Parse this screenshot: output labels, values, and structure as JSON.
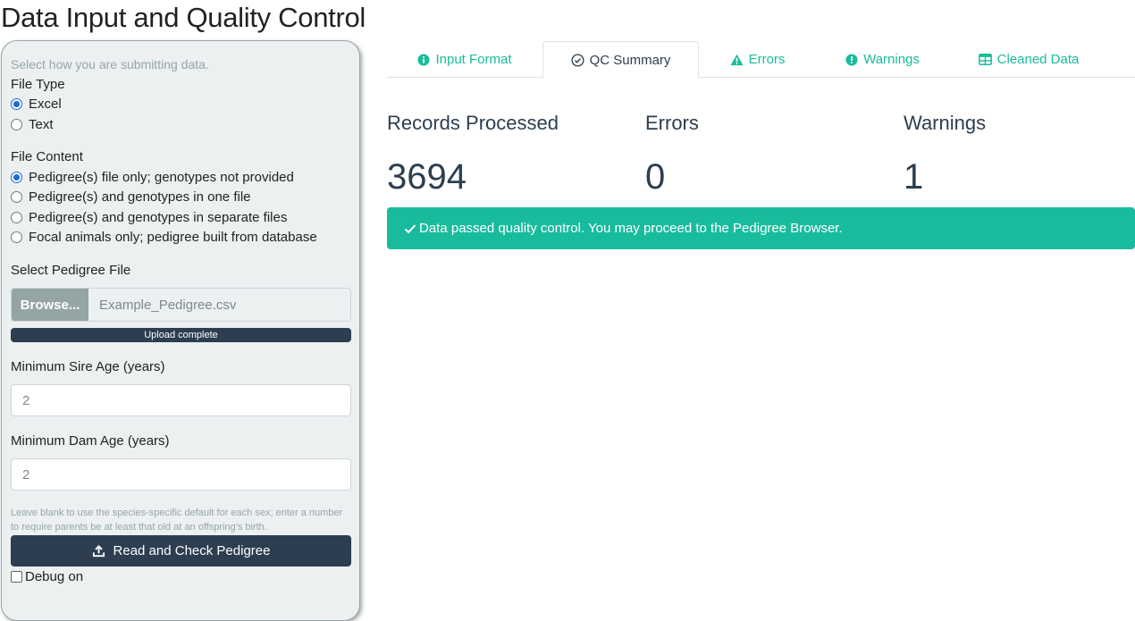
{
  "page": {
    "title": "Data Input and Quality Control"
  },
  "sidebar": {
    "hint": "Select how you are submitting data.",
    "file_type": {
      "label": "File Type",
      "options": [
        "Excel",
        "Text"
      ],
      "selected": "Excel"
    },
    "file_content": {
      "label": "File Content",
      "options": [
        "Pedigree(s) file only; genotypes not provided",
        "Pedigree(s) and genotypes in one file",
        "Pedigree(s) and genotypes in separate files",
        "Focal animals only; pedigree built from database"
      ],
      "selected": "Pedigree(s) file only; genotypes not provided"
    },
    "pedigree_file": {
      "label": "Select Pedigree File",
      "browse_label": "Browse...",
      "file_name": "Example_Pedigree.csv",
      "upload_status": "Upload complete",
      "upload_progress": 1.0
    },
    "min_sire_age": {
      "label": "Minimum Sire Age (years)",
      "value": "2"
    },
    "min_dam_age": {
      "label": "Minimum Dam Age (years)",
      "value": "2"
    },
    "help_text": "Leave blank to use the species-specific default for each sex; enter a number to require parents be at least that old at an offspring's birth.",
    "read_button": {
      "label": "Read and Check Pedigree",
      "icon": "upload-icon"
    },
    "debug": {
      "label": "Debug on",
      "checked": false
    }
  },
  "tabs": [
    {
      "label": "Input Format",
      "icon": "info-circle-icon",
      "active": false
    },
    {
      "label": "QC Summary",
      "icon": "check-circle-icon",
      "active": true
    },
    {
      "label": "Errors",
      "icon": "warning-triangle-icon",
      "active": false
    },
    {
      "label": "Warnings",
      "icon": "exclamation-circle-icon",
      "active": false
    },
    {
      "label": "Cleaned Data",
      "icon": "table-icon",
      "active": false
    }
  ],
  "summary": {
    "records": {
      "label": "Records Processed",
      "value": "3694"
    },
    "errors": {
      "label": "Errors",
      "value": "0"
    },
    "warnings": {
      "label": "Warnings",
      "value": "1"
    }
  },
  "alert": {
    "text": "Data passed quality control. You may proceed to the Pedigree Browser.",
    "icon": "checkmark-icon"
  },
  "colors": {
    "primary": "#2c3e50",
    "success": "#18bc9c",
    "sidebar_bg": "#ecf0f1",
    "muted": "#95a5a6"
  }
}
